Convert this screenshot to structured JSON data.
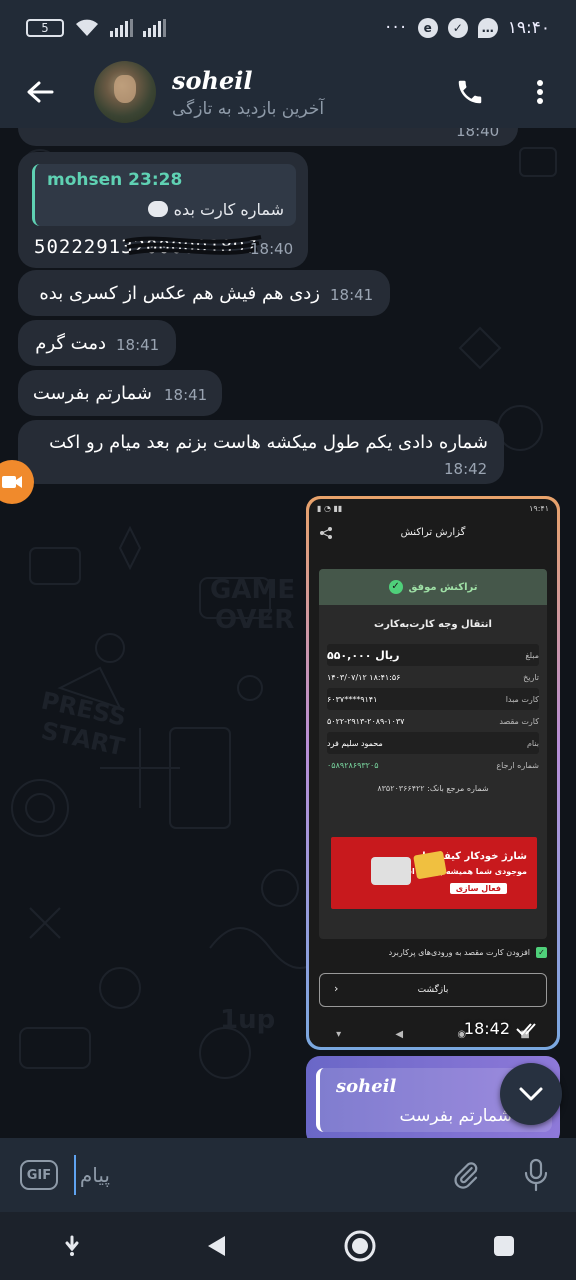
{
  "status_bar": {
    "battery": "5",
    "time": "۱۹:۴۰",
    "dots": "···"
  },
  "header": {
    "name": "soheil",
    "status": "آخرین بازدید به تازگی"
  },
  "messages": [
    {
      "text": "",
      "time": "18:40"
    },
    {
      "reply_name": "mohsen 23:28",
      "reply_text": "شماره کارت بده",
      "text": "502229132000001897",
      "time": "18:40"
    },
    {
      "text": "زدی هم فیش هم عکس از کسری بده",
      "time": "18:41"
    },
    {
      "text": "دمت گرم",
      "time": "18:41"
    },
    {
      "text": "شمارتم بفرست",
      "time": "18:41"
    },
    {
      "text": "شماره دادی یکم طول میکشه هاست بزنم بعد میام رو اکت",
      "time": "18:42"
    }
  ],
  "receipt": {
    "status_time": "۱۹:۴۱",
    "title": "گزارش تراکنش",
    "success": "تراکنش موفق",
    "heading": "انتقال وجه کارت‌به‌کارت",
    "rows": [
      {
        "label": "مبلغ",
        "value": "۵۵۰,۰۰۰ ریال"
      },
      {
        "label": "تاریخ",
        "value": "۱۴۰۳/۰۷/۱۲ ۱۸:۴۱:۵۶"
      },
      {
        "label": "کارت مبدا",
        "value": "۶۰۳۷****۹۱۴۱"
      },
      {
        "label": "کارت مقصد",
        "value": "۵۰۲۲-۲۹۱۳-۲۰۸۹-۱۰۳۷"
      },
      {
        "label": "بنام",
        "value": "محمود سلیم فرد"
      },
      {
        "label": "شماره ارجاع",
        "value": "۰۵۸۹۲۸۶۹۳۲۰۵"
      }
    ],
    "bank_ref": "شماره مرجع بانک: ۸۳۵۲۰۳۶۶۴۲۲",
    "banner_title": "شارژ خودکار کیف پول",
    "banner_sub": "موجودی شما همیشه برقرار است",
    "banner_btn": "فعال سازی",
    "agree_text": "افزودن کارت مقصد به ورودی‌های پرکاربرد",
    "back_label": "بازگشت",
    "media_time": "18:42"
  },
  "forwarded": {
    "name": "soheil",
    "text": "شمارتم بفرست"
  },
  "input": {
    "placeholder": "پیام",
    "gif_label": "GIF"
  }
}
